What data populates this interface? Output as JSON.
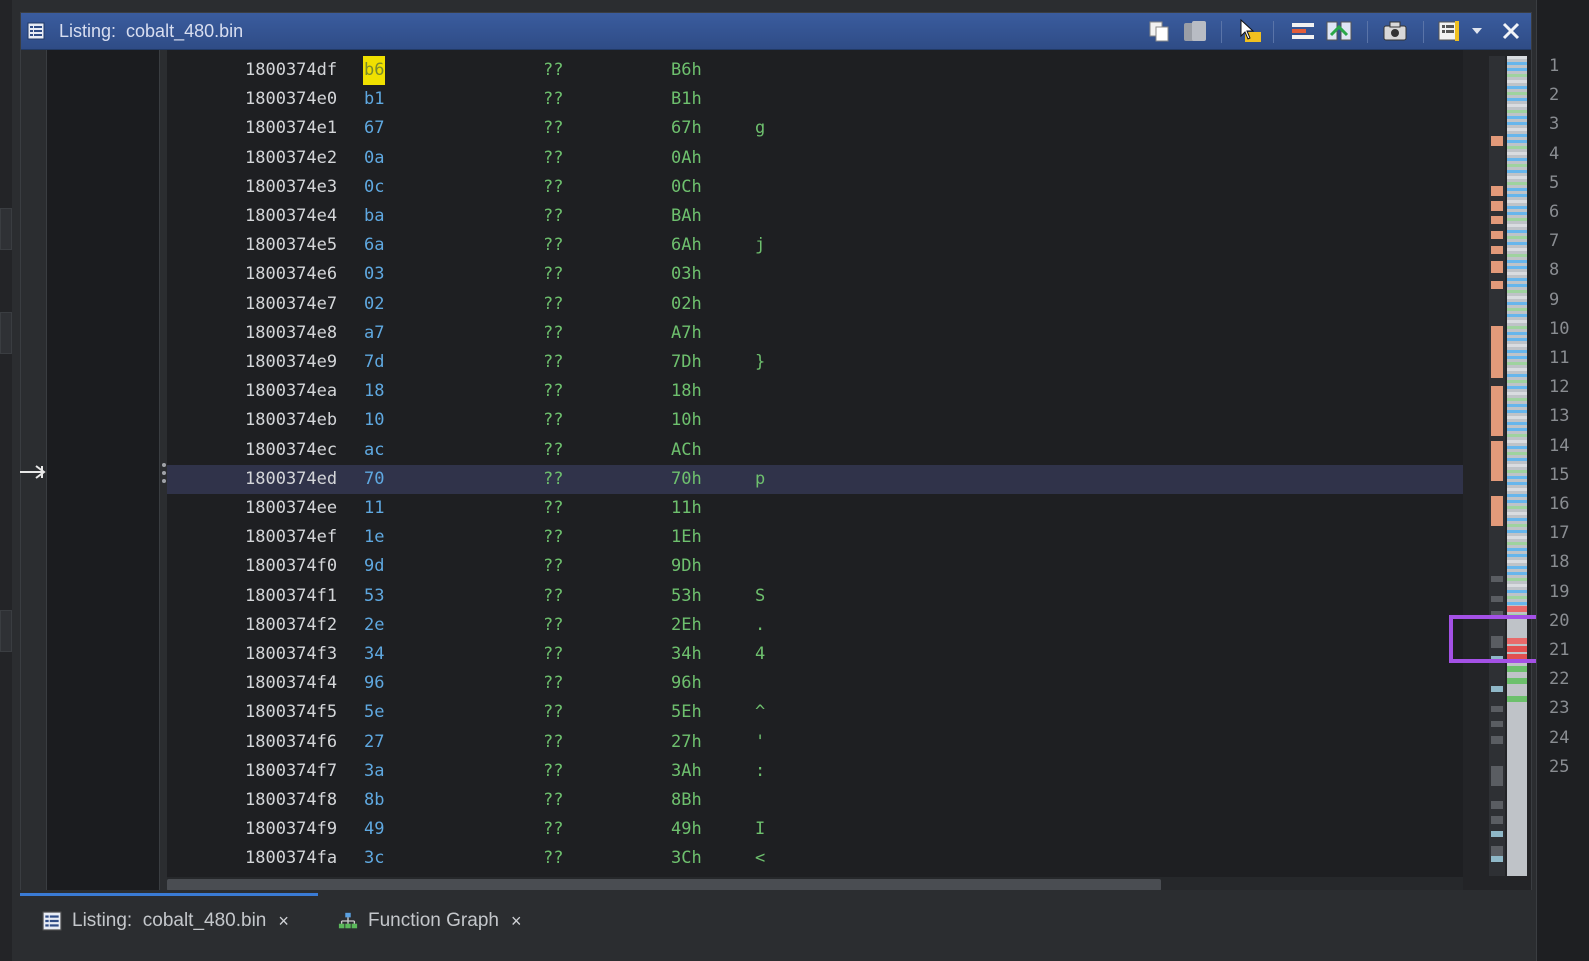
{
  "window": {
    "title": "Listing:  cobalt_480.bin"
  },
  "toolbar": {
    "icons": [
      "copy-icon",
      "paste-icon",
      "cursor-highlight-icon",
      "field-layout-icon",
      "diff-icon",
      "snapshot-icon",
      "options-icon",
      "dropdown-icon",
      "close-icon"
    ]
  },
  "listing": {
    "rows": [
      {
        "address": "1800374df",
        "byte": "b6",
        "mnemonic": "??",
        "value": "B6h",
        "char": ""
      },
      {
        "address": "1800374e0",
        "byte": "b1",
        "mnemonic": "??",
        "value": "B1h",
        "char": ""
      },
      {
        "address": "1800374e1",
        "byte": "67",
        "mnemonic": "??",
        "value": "67h",
        "char": "g"
      },
      {
        "address": "1800374e2",
        "byte": "0a",
        "mnemonic": "??",
        "value": "0Ah",
        "char": ""
      },
      {
        "address": "1800374e3",
        "byte": "0c",
        "mnemonic": "??",
        "value": "0Ch",
        "char": ""
      },
      {
        "address": "1800374e4",
        "byte": "ba",
        "mnemonic": "??",
        "value": "BAh",
        "char": ""
      },
      {
        "address": "1800374e5",
        "byte": "6a",
        "mnemonic": "??",
        "value": "6Ah",
        "char": "j"
      },
      {
        "address": "1800374e6",
        "byte": "03",
        "mnemonic": "??",
        "value": "03h",
        "char": ""
      },
      {
        "address": "1800374e7",
        "byte": "02",
        "mnemonic": "??",
        "value": "02h",
        "char": ""
      },
      {
        "address": "1800374e8",
        "byte": "a7",
        "mnemonic": "??",
        "value": "A7h",
        "char": ""
      },
      {
        "address": "1800374e9",
        "byte": "7d",
        "mnemonic": "??",
        "value": "7Dh",
        "char": "}"
      },
      {
        "address": "1800374ea",
        "byte": "18",
        "mnemonic": "??",
        "value": "18h",
        "char": ""
      },
      {
        "address": "1800374eb",
        "byte": "10",
        "mnemonic": "??",
        "value": "10h",
        "char": ""
      },
      {
        "address": "1800374ec",
        "byte": "ac",
        "mnemonic": "??",
        "value": "ACh",
        "char": ""
      },
      {
        "address": "1800374ed",
        "byte": "70",
        "mnemonic": "??",
        "value": "70h",
        "char": "p"
      },
      {
        "address": "1800374ee",
        "byte": "11",
        "mnemonic": "??",
        "value": "11h",
        "char": ""
      },
      {
        "address": "1800374ef",
        "byte": "1e",
        "mnemonic": "??",
        "value": "1Eh",
        "char": ""
      },
      {
        "address": "1800374f0",
        "byte": "9d",
        "mnemonic": "??",
        "value": "9Dh",
        "char": ""
      },
      {
        "address": "1800374f1",
        "byte": "53",
        "mnemonic": "??",
        "value": "53h",
        "char": "S"
      },
      {
        "address": "1800374f2",
        "byte": "2e",
        "mnemonic": "??",
        "value": "2Eh",
        "char": "."
      },
      {
        "address": "1800374f3",
        "byte": "34",
        "mnemonic": "??",
        "value": "34h",
        "char": "4"
      },
      {
        "address": "1800374f4",
        "byte": "96",
        "mnemonic": "??",
        "value": "96h",
        "char": ""
      },
      {
        "address": "1800374f5",
        "byte": "5e",
        "mnemonic": "??",
        "value": "5Eh",
        "char": "^"
      },
      {
        "address": "1800374f6",
        "byte": "27",
        "mnemonic": "??",
        "value": "27h",
        "char": "'"
      },
      {
        "address": "1800374f7",
        "byte": "3a",
        "mnemonic": "??",
        "value": "3Ah",
        "char": ":"
      },
      {
        "address": "1800374f8",
        "byte": "8b",
        "mnemonic": "??",
        "value": "8Bh",
        "char": ""
      },
      {
        "address": "1800374f9",
        "byte": "49",
        "mnemonic": "??",
        "value": "49h",
        "char": "I"
      },
      {
        "address": "1800374fa",
        "byte": "3c",
        "mnemonic": "??",
        "value": "3Ch",
        "char": "<"
      }
    ],
    "highlighted_row_index": 0,
    "selected_row_index": 14
  },
  "right_panel": {
    "line_numbers": [
      "1",
      "2",
      "3",
      "4",
      "5",
      "6",
      "7",
      "8",
      "9",
      "10",
      "11",
      "12",
      "13",
      "14",
      "15",
      "16",
      "17",
      "18",
      "19",
      "20",
      "21",
      "22",
      "23",
      "24",
      "25"
    ]
  },
  "tabs": [
    {
      "label": "Listing:  cobalt_480.bin",
      "close": "×",
      "icon": "listing-icon"
    },
    {
      "label": "Function Graph",
      "close": "×",
      "icon": "function-graph-icon"
    }
  ],
  "colors": {
    "title_bar": "#2f4c86",
    "byte_highlight": "#f0e000",
    "focus_box": "#a451e6",
    "active_tab_line": "#3a7bd5"
  }
}
